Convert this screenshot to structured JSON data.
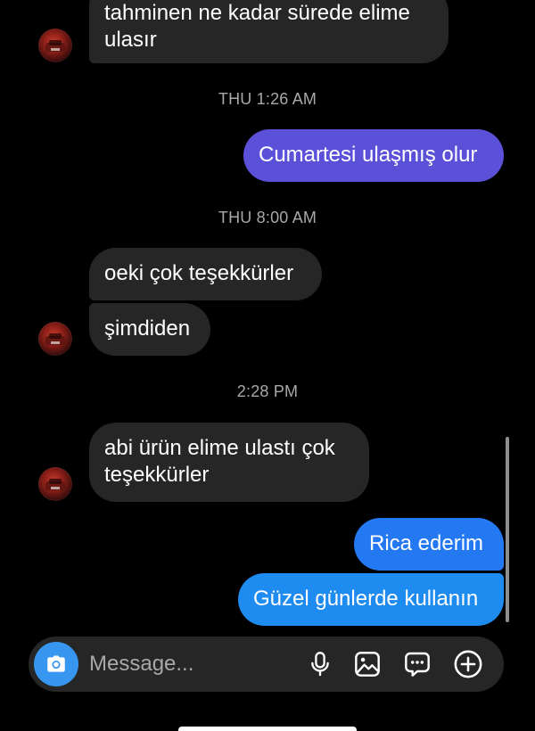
{
  "thread": {
    "messages": [
      {
        "id": "m1",
        "direction": "incoming",
        "text": "tahminen ne kadar sürede elime ulasır",
        "line1": "tahminen ne kadar sürede elime",
        "line2": "ulasır"
      },
      {
        "id": "t1",
        "type": "timestamp",
        "text": "THU 1:26 AM"
      },
      {
        "id": "m2",
        "direction": "outgoing",
        "text": "Cumartesi ulaşmış olur"
      },
      {
        "id": "t2",
        "type": "timestamp",
        "text": "THU 8:00 AM"
      },
      {
        "id": "m3",
        "direction": "incoming",
        "text": "oeki çok teşekkürler"
      },
      {
        "id": "m4",
        "direction": "incoming",
        "text": "şimdiden"
      },
      {
        "id": "t3",
        "type": "timestamp",
        "text": "2:28 PM"
      },
      {
        "id": "m5",
        "direction": "incoming",
        "text": "abi ürün elime ulastı çok teşekkürler",
        "line1": "abi ürün elime ulastı çok",
        "line2": "teşekkürler"
      },
      {
        "id": "m6",
        "direction": "outgoing",
        "text": "Rica ederim"
      },
      {
        "id": "m7",
        "direction": "outgoing",
        "text": "Güzel günlerde kullanın"
      }
    ]
  },
  "composer": {
    "placeholder": "Message...",
    "value": "",
    "icons": [
      "camera-icon",
      "microphone-icon",
      "image-icon",
      "sticker-chat-icon",
      "plus-circle-icon"
    ]
  },
  "colors": {
    "background": "#000000",
    "incoming_bubble": "#262626",
    "outgoing_gradient_top": "#5b51d8",
    "outgoing_gradient_bottom": "#1d8bf0",
    "timestamp": "#a8a8a8",
    "camera_button": "#3797f0"
  }
}
